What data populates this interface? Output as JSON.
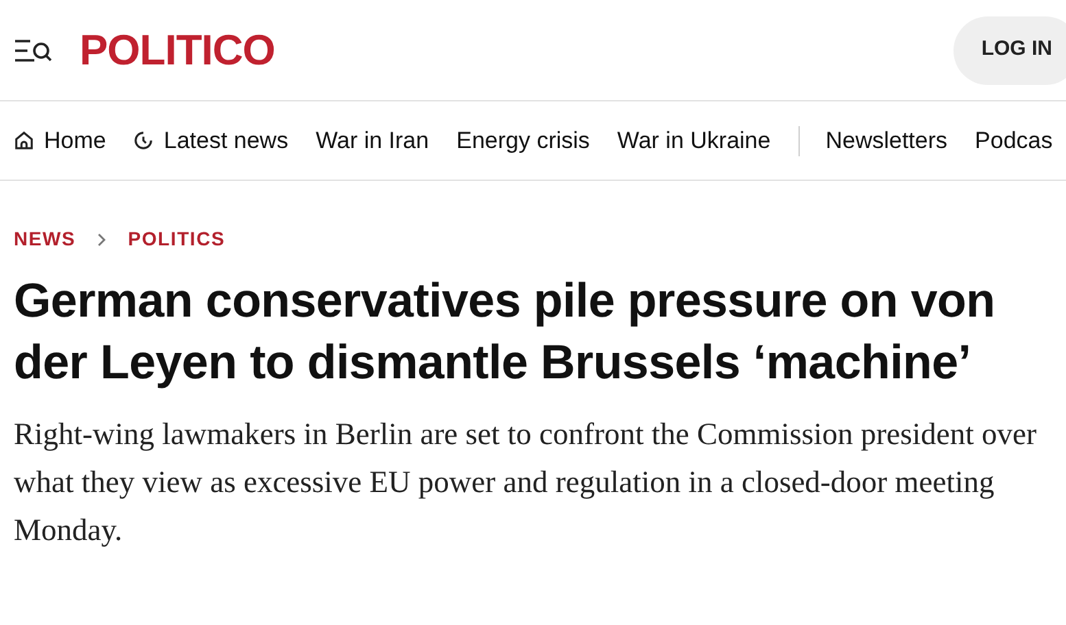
{
  "header": {
    "logo": "POLITICO",
    "login_button": "LOG IN"
  },
  "nav": [
    {
      "label": "Home",
      "kind": "home",
      "divider_before": false
    },
    {
      "label": "Latest news",
      "kind": "latest",
      "divider_before": false
    },
    {
      "label": "War in Iran",
      "kind": "topic",
      "divider_before": false
    },
    {
      "label": "Energy crisis",
      "kind": "topic",
      "divider_before": false
    },
    {
      "label": "War in Ukraine",
      "kind": "topic",
      "divider_before": false
    },
    {
      "label": "Newsletters",
      "kind": "topic",
      "divider_before": true
    },
    {
      "label": "Podcas",
      "kind": "topic",
      "divider_before": false
    }
  ],
  "breadcrumb": [
    "NEWS",
    "POLITICS"
  ],
  "headline": "German conservatives pile pressure on von der Leyen to dismantle Brussels ‘machine’",
  "summary": "Right-wing lawmakers in Berlin are set to confront the Commission president over what they view as excessive EU power and regulation in a closed-door meeting Monday."
}
